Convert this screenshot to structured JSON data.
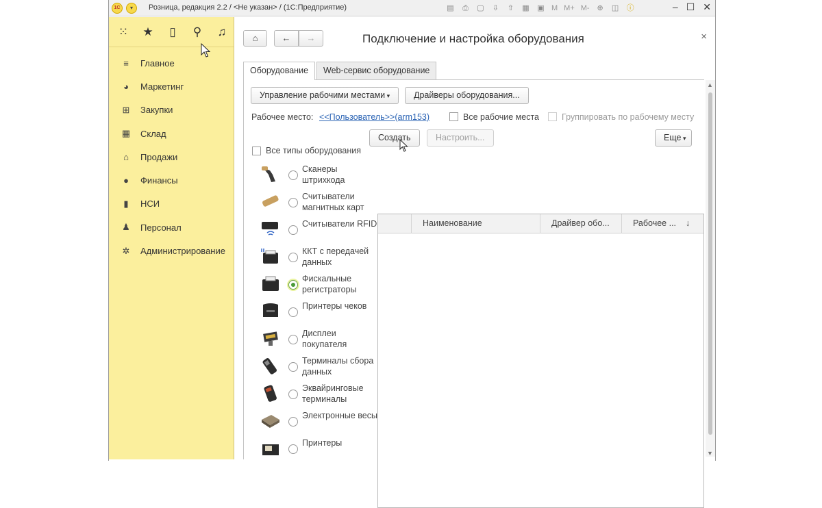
{
  "window": {
    "title": "Розница, редакция 2.2 / <Не указан> / (1С:Предприятие)",
    "logo_text": "1С",
    "toolbar_text": [
      "M",
      "M+",
      "M-"
    ]
  },
  "sidebar": {
    "items": [
      {
        "label": "Главное",
        "icon": "menu-icon"
      },
      {
        "label": "Маркетинг",
        "icon": "pie-chart-icon"
      },
      {
        "label": "Закупки",
        "icon": "cart-icon"
      },
      {
        "label": "Склад",
        "icon": "warehouse-icon"
      },
      {
        "label": "Продажи",
        "icon": "basket-icon"
      },
      {
        "label": "Финансы",
        "icon": "coin-icon"
      },
      {
        "label": "НСИ",
        "icon": "books-icon"
      },
      {
        "label": "Персонал",
        "icon": "person-icon"
      },
      {
        "label": "Администрирование",
        "icon": "gear-icon"
      }
    ]
  },
  "form": {
    "title": "Подключение и настройка оборудования",
    "tabs": [
      "Оборудование",
      "Web-сервис оборудование"
    ],
    "manage_workplaces": "Управление рабочими местами",
    "drivers": "Драйверы оборудования...",
    "workplace_label": "Рабочее место:",
    "workplace_value": "<<Пользователь>>(arm153)",
    "all_workplaces": "Все рабочие места",
    "group_by_workplace": "Группировать по рабочему месту",
    "all_types": "Все типы оборудования",
    "create": "Создать",
    "configure": "Настроить...",
    "more": "Еще",
    "columns": [
      "Наименование",
      "Драйвер обо...",
      "Рабочее ..."
    ],
    "sort_arrow": "↓"
  },
  "equipment": [
    {
      "name": "Сканеры штрихкода",
      "selected": false
    },
    {
      "name": "Считыватели магнитных карт",
      "selected": false
    },
    {
      "name": "Считыватели RFID",
      "selected": false
    },
    {
      "name": "ККТ с передачей данных",
      "selected": false
    },
    {
      "name": "Фискальные регистраторы",
      "selected": true
    },
    {
      "name": "Принтеры чеков",
      "selected": false
    },
    {
      "name": "Дисплеи покупателя",
      "selected": false
    },
    {
      "name": "Терминалы сбора данных",
      "selected": false
    },
    {
      "name": "Эквайринговые терминалы",
      "selected": false
    },
    {
      "name": "Электронные весы",
      "selected": false
    },
    {
      "name": "Принтеры",
      "selected": false
    }
  ]
}
